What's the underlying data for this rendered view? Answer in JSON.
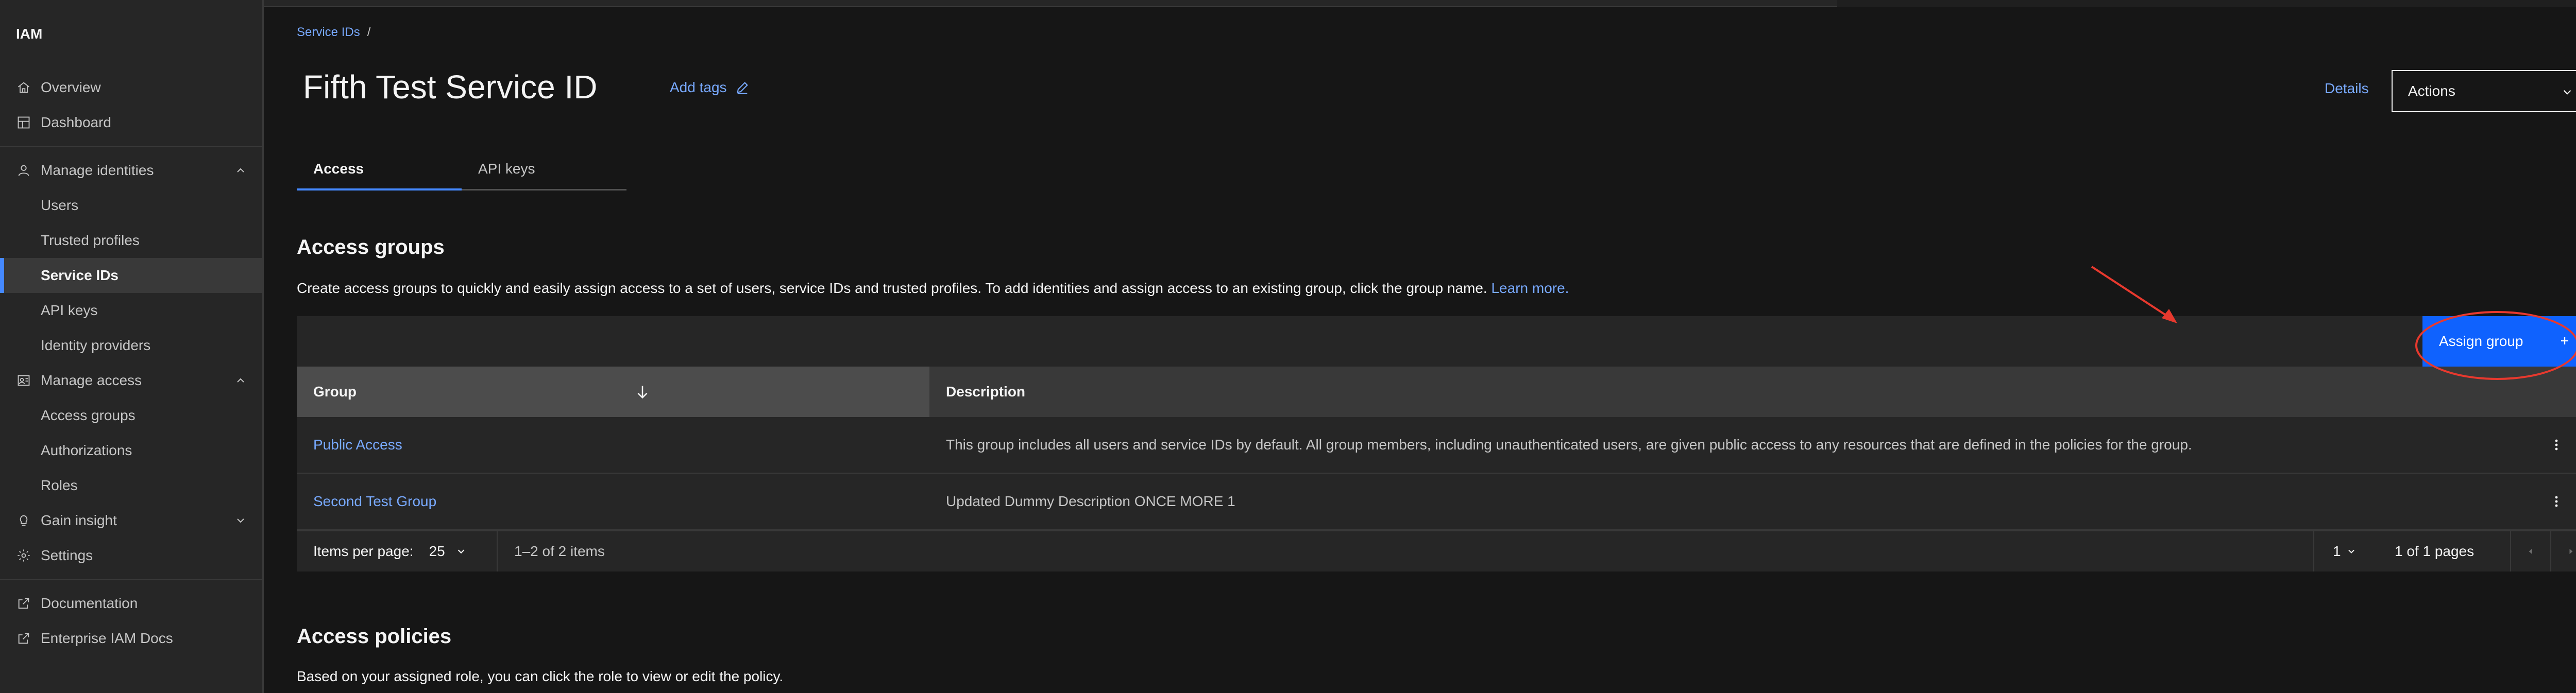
{
  "sidebar": {
    "brand": "IAM",
    "items": [
      {
        "label": "Overview"
      },
      {
        "label": "Dashboard"
      },
      {
        "label": "Manage identities"
      },
      {
        "label": "Users"
      },
      {
        "label": "Trusted profiles"
      },
      {
        "label": "Service IDs"
      },
      {
        "label": "API keys"
      },
      {
        "label": "Identity providers"
      },
      {
        "label": "Manage access"
      },
      {
        "label": "Access groups"
      },
      {
        "label": "Authorizations"
      },
      {
        "label": "Roles"
      },
      {
        "label": "Gain insight"
      },
      {
        "label": "Settings"
      },
      {
        "label": "Documentation"
      },
      {
        "label": "Enterprise IAM Docs"
      }
    ]
  },
  "breadcrumb": {
    "link": "Service IDs",
    "separator": "/"
  },
  "header": {
    "title": "Fifth Test Service ID",
    "add_tags": "Add tags",
    "details": "Details",
    "actions": "Actions"
  },
  "tabs": [
    {
      "label": "Access"
    },
    {
      "label": "API keys"
    }
  ],
  "access_groups": {
    "title": "Access groups",
    "description": "Create access groups to quickly and easily assign access to a set of users, service IDs and trusted profiles. To add identities and assign access to an existing group, click the group name.",
    "learn_more": "Learn more.",
    "assign_button": "Assign group",
    "columns": {
      "group": "Group",
      "description": "Description"
    },
    "rows": [
      {
        "group": "Public Access",
        "description": "This group includes all users and service IDs by default. All group members, including unauthenticated users, are given public access to any resources that are defined in the policies for the group."
      },
      {
        "group": "Second Test Group",
        "description": "Updated Dummy Description ONCE MORE 1"
      }
    ],
    "pagination": {
      "items_per_page_label": "Items per page:",
      "items_per_page": "25",
      "range": "1–2 of 2 items",
      "page": "1",
      "of_pages": "1 of 1 pages"
    }
  },
  "access_policies": {
    "title": "Access policies",
    "description": "Based on your assigned role, you can click the role to view or edit the policy."
  },
  "colors": {
    "accent": "#0f62fe",
    "link": "#78a9ff",
    "annotation": "#e8392e"
  }
}
